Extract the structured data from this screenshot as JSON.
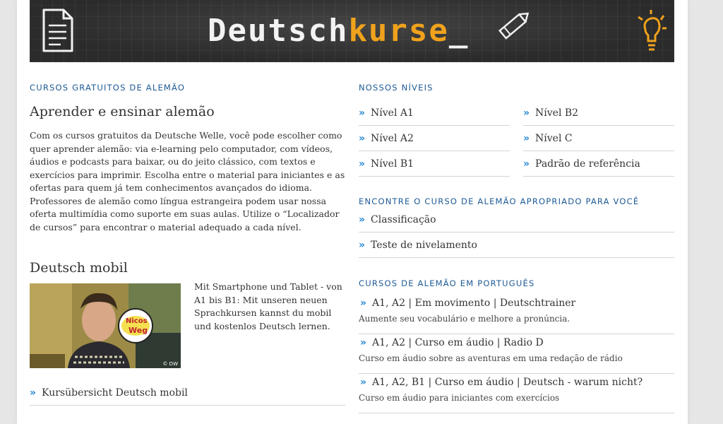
{
  "banner": {
    "brand_white": "Deutsch",
    "brand_orange": "kurse",
    "brand_underscore": "_"
  },
  "left": {
    "section_label": "CURSOS GRATUITOS DE ALEMÃO",
    "heading": "Aprender e ensinar alemão",
    "paragraph": "Com os cursos gratuitos da Deutsche Welle, você pode escolher como quer aprender alemão: via e-learning pelo computador, com vídeos, áudios e podcasts para baixar, ou do jeito clássico, com textos e exercícios para imprimir. Escolha entre o material para iniciantes e as ofertas para quem já tem conhecimentos avançados do idioma. Professores de alemão como língua estrangeira podem usar nossa oferta multimídia como suporte em suas aulas. Utilize o “Localizador de cursos” para encontrar o material adequado a cada nível.",
    "mobil_heading": "Deutsch mobil",
    "mobil_text": "Mit Smartphone und Tablet - von A1 bis B1: Mit unseren neuen Sprachkursen kannst du mobil und kostenlos Deutsch lernen.",
    "photo_badge_line1": "Nicos",
    "photo_badge_line2": "Weg",
    "photo_credit": "© DW",
    "mobil_link": "Kursübersicht Deutsch mobil"
  },
  "right": {
    "levels_label": "NOSSOS NÍVEIS",
    "levels_col1": [
      "Nível A1",
      "Nível A2",
      "Nível B1"
    ],
    "levels_col2": [
      "Nível B2",
      "Nível C",
      "Padrão de referência"
    ],
    "finder_label": "ENCONTRE O CURSO DE ALEMÃO APROPRIADO PARA VOCÊ",
    "finder_links": [
      "Classificação",
      "Teste de nivelamento"
    ],
    "pt_label": "CURSOS DE ALEMÃO EM PORTUGUÊS",
    "courses": [
      {
        "title": "A1, A2 | Em movimento | Deutschtrainer",
        "sub": "Aumente seu vocabulário e melhore a pronúncia."
      },
      {
        "title": "A1, A2 | Curso em áudio | Radio D",
        "sub": "Curso em áudio sobre as aventuras em uma redação de rádio"
      },
      {
        "title": "A1, A2, B1 | Curso em áudio | Deutsch - warum nicht?",
        "sub": "Curso em áudio para iniciantes com exercícios"
      }
    ]
  },
  "chevron": "»",
  "colors": {
    "accent_blue": "#1d5a94",
    "chevron_blue": "#2a8ad4",
    "brand_orange": "#f0a21c",
    "banner_bg": "#2f2f2f"
  }
}
